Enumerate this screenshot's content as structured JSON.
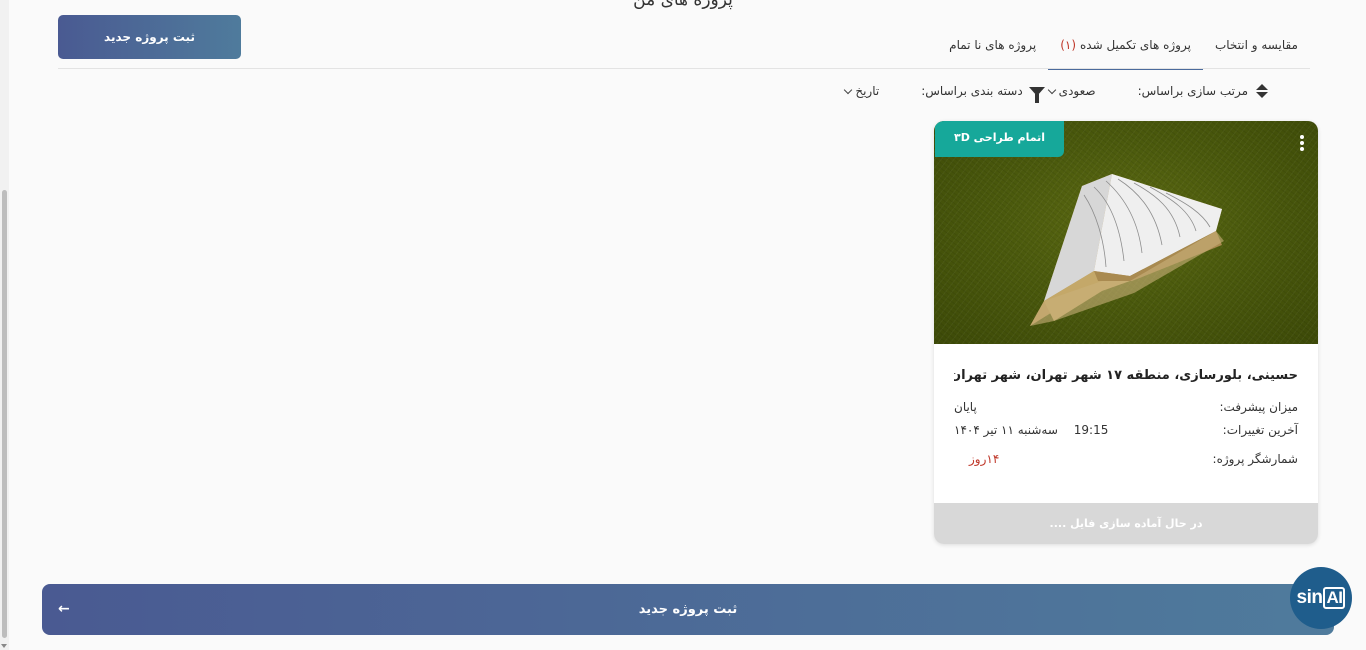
{
  "page": {
    "title": "پروژه های من"
  },
  "header": {
    "new_project_label": "ثبت پروژه جدید"
  },
  "tabs": [
    {
      "label": "پروژه های نا تمام",
      "count": ""
    },
    {
      "label": "پروژه های تکمیل شده",
      "count": "(۱)"
    },
    {
      "label": "مقایسه و انتخاب",
      "count": ""
    }
  ],
  "filters": {
    "group_by_label": "دسته بندی براساس:",
    "group_by_value": "تاریخ",
    "sort_by_label": "مرتب سازی براساس:",
    "sort_by_value": "صعودی"
  },
  "project_card": {
    "status_badge": "اتمام طراحی ۳D",
    "title": "حسینی، بلورسازی، منطقه ۱۷ شهر تهران، شهر تهران",
    "progress_label": "میزان پیشرفت:",
    "progress_value": "پایان",
    "last_change_label": "آخرین تغییرات:",
    "last_change_date": "سه‌شنبه ۱۱ تیر ۱۴۰۴",
    "last_change_time": "19:15",
    "counter_label": "شمارشگر پروژه:",
    "counter_value": "۱۴روز",
    "footer_status": "در حال آماده سازی فایل ...."
  },
  "bottom_bar": {
    "new_project_label": "ثبت پروژه جدید",
    "arrow": "←"
  },
  "assistant": {
    "logo_text_1": "sin",
    "logo_text_2": "AI"
  },
  "colors": {
    "primary_gradient_start": "#4a5a92",
    "primary_gradient_end": "#4f7b9c",
    "badge_teal": "#16a89a",
    "alert_red": "#c0392b",
    "assistant_blue": "#1f5d8c"
  }
}
